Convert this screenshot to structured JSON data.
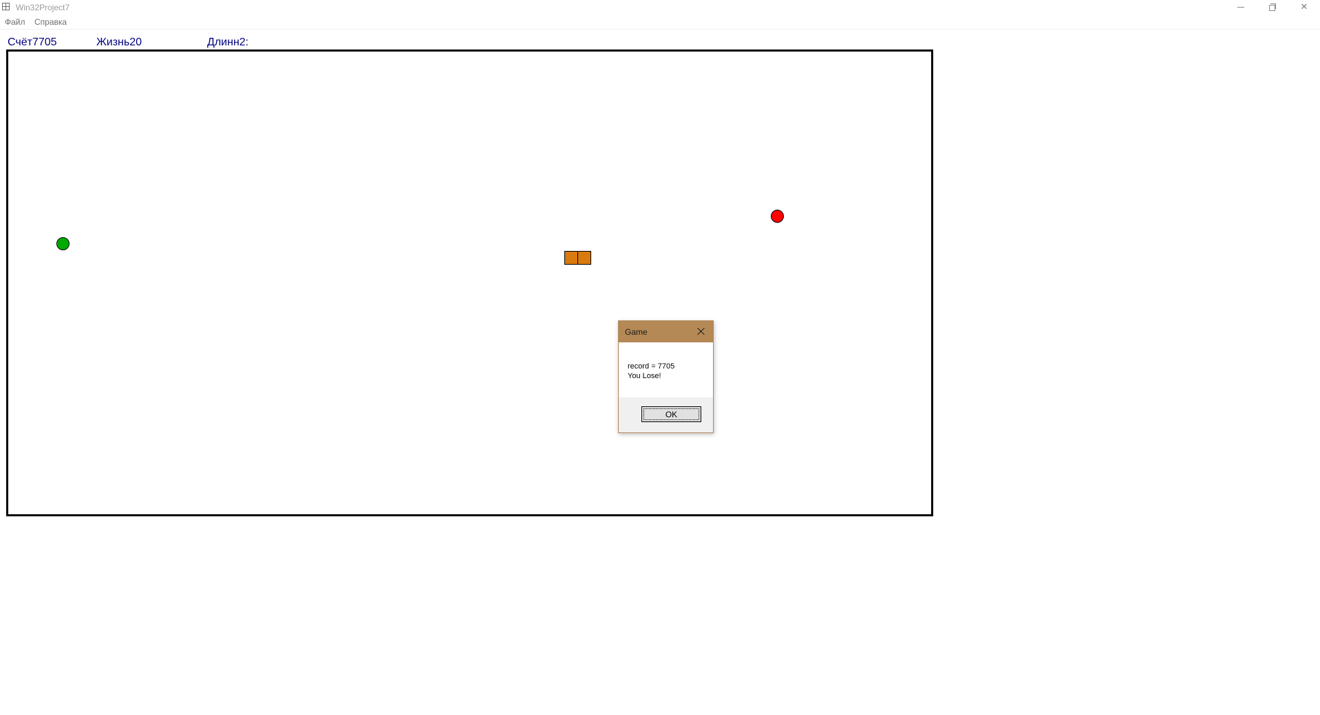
{
  "window": {
    "title": "Win32Project7",
    "icon": "app-window-icon",
    "controls": [
      "minimize-icon",
      "restore-icon",
      "close-icon"
    ]
  },
  "menu": {
    "items": [
      {
        "label": "Файл"
      },
      {
        "label": "Справка"
      }
    ]
  },
  "status": {
    "score": "Счёт7705",
    "life": "Жизнь20",
    "length": "Длинн2:"
  },
  "game": {
    "snake_segments": 2,
    "colors": {
      "field_border": "#000000",
      "apple_good": "#00aa00",
      "apple_bad": "#ff0000",
      "snake": "#d97a0f",
      "status_text": "#000080"
    }
  },
  "dialog": {
    "title": "Game",
    "line1": "record = 7705",
    "line2": "You Lose!",
    "ok_label": "OK",
    "accent": "#b48956"
  }
}
